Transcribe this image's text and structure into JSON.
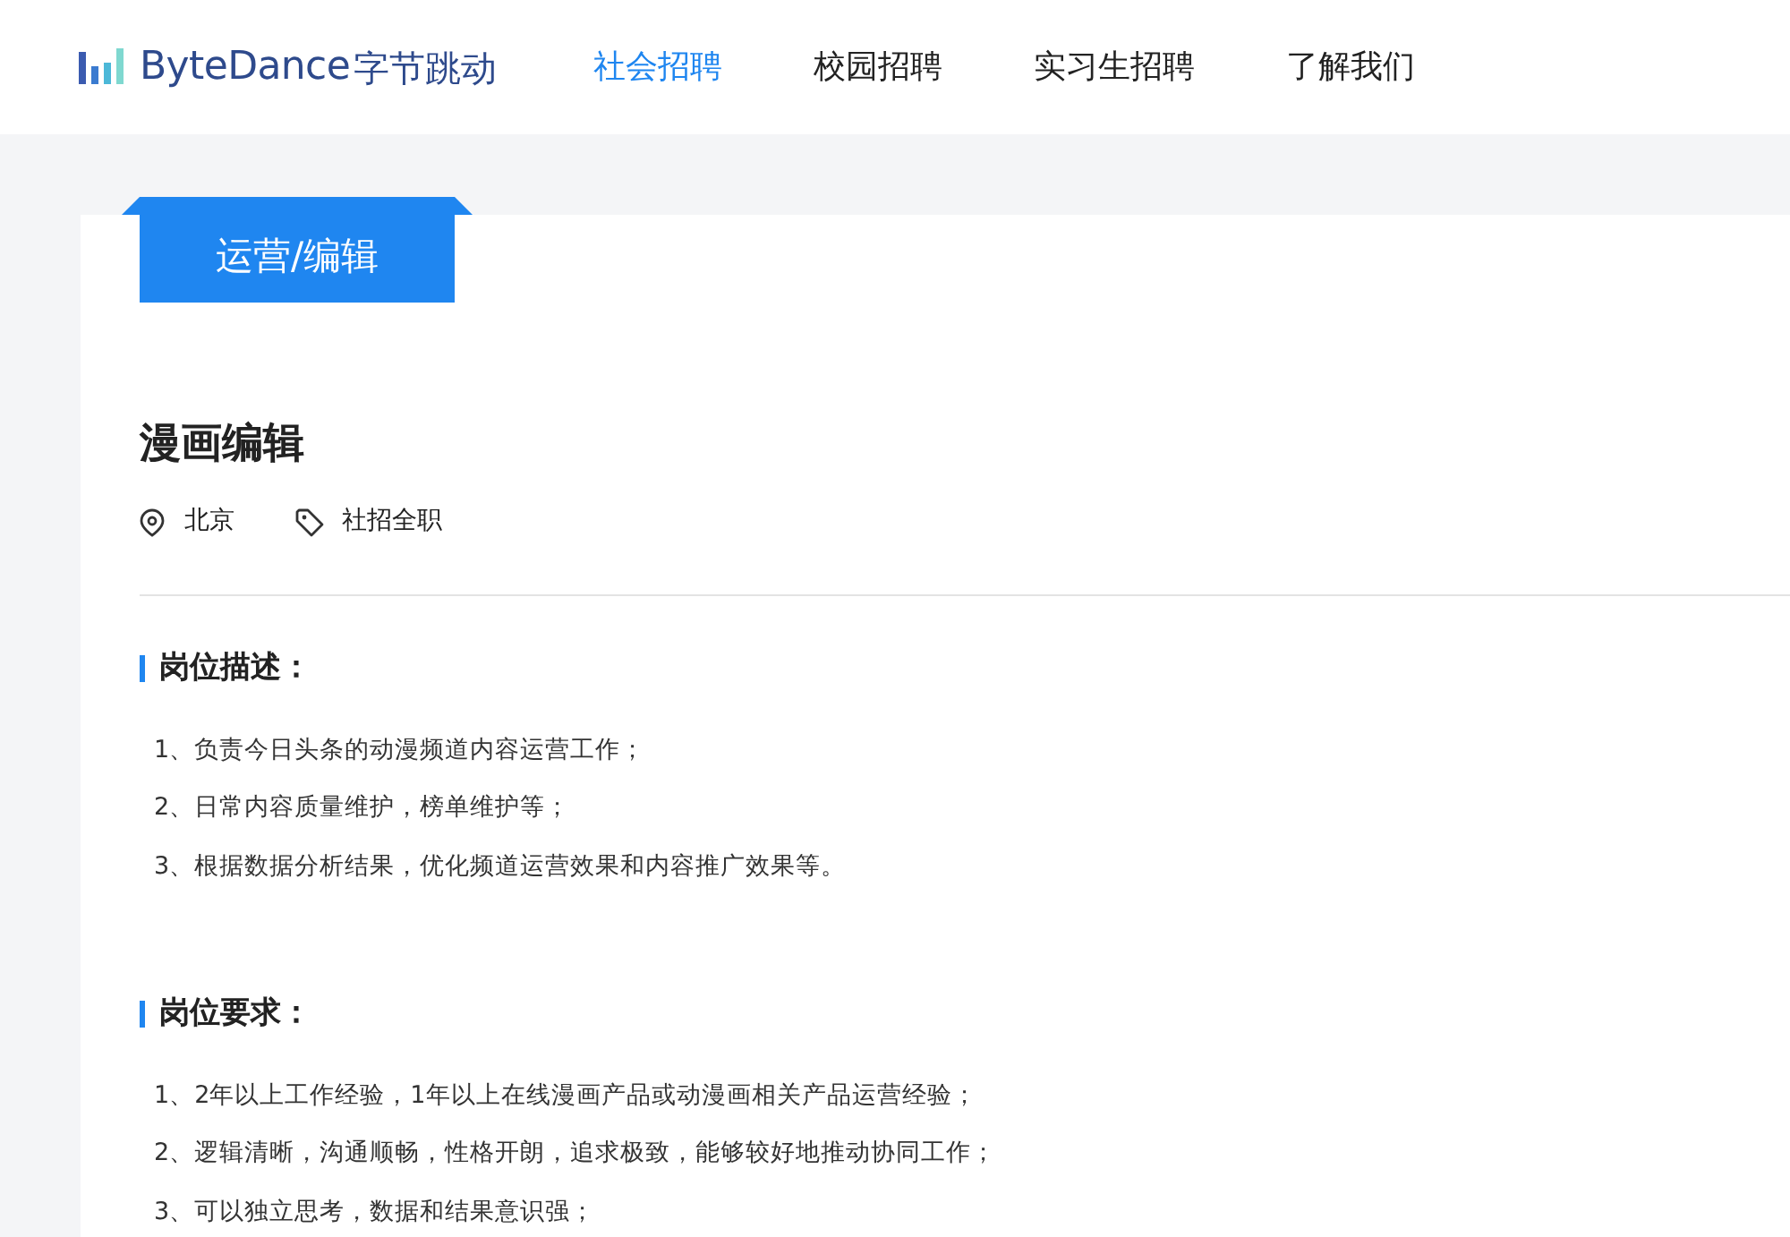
{
  "header": {
    "brand": {
      "name": "ByteDance",
      "name_local": "字节跳动"
    },
    "nav": [
      {
        "label": "社会招聘",
        "selected": true
      },
      {
        "label": "校园招聘",
        "selected": false
      },
      {
        "label": "实习生招聘",
        "selected": false
      },
      {
        "label": "了解我们",
        "selected": false
      }
    ]
  },
  "job": {
    "category": "运营/编辑",
    "title": "漫画编辑",
    "location": "北京",
    "type": "社招全职",
    "sections": [
      {
        "heading": "岗位描述：",
        "items": [
          "1、负责今日头条的动漫频道内容运营工作；",
          "2、日常内容质量维护，榜单维护等；",
          "3、根据数据分析结果，优化频道运营效果和内容推广效果等。"
        ]
      },
      {
        "heading": "岗位要求：",
        "items": [
          "1、2年以上工作经验，1年以上在线漫画产品或动漫画相关产品运营经验；",
          "2、逻辑清晰，沟通顺畅，性格开朗，追求极致，能够较好地推动协同工作；",
          "3、可以独立思考，数据和结果意识强；"
        ]
      }
    ]
  }
}
